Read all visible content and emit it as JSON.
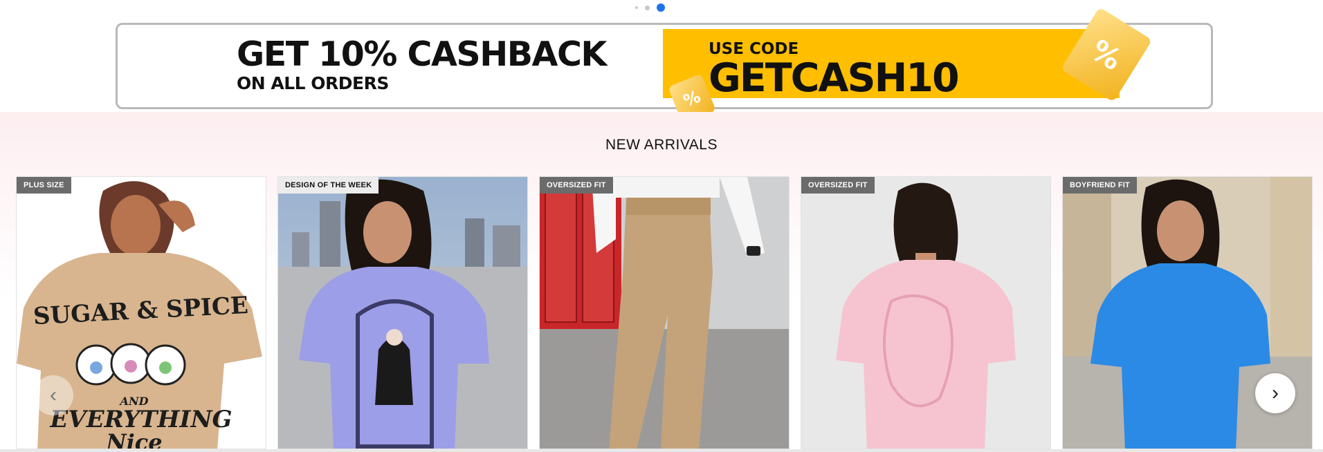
{
  "carousel": {
    "dots": [
      {
        "label": "slide-1",
        "active": false
      },
      {
        "label": "slide-2",
        "active": false
      },
      {
        "label": "slide-3",
        "active": true
      }
    ]
  },
  "banner": {
    "headline": "GET 10% CASHBACK",
    "subline": "ON ALL ORDERS",
    "code_label": "USE CODE",
    "code_value": "GETCASH10",
    "ticket_symbol": "%",
    "colors": {
      "code_bg": "#ffbe00",
      "border": "#b9b9b9"
    }
  },
  "arrivals": {
    "title": "NEW ARRIVALS",
    "products": [
      {
        "tag": "PLUS SIZE",
        "print_text": [
          "SUGAR & SPICE",
          "AND",
          "EVERYTHING",
          "Nice"
        ]
      },
      {
        "tag": "DESIGN OF THE WEEK",
        "print_text": []
      },
      {
        "tag": "OVERSIZED FIT",
        "print_text": []
      },
      {
        "tag": "OVERSIZED FIT",
        "print_text": []
      },
      {
        "tag": "BOYFRIEND FIT",
        "print_text": []
      }
    ],
    "prev_icon": "‹",
    "next_icon": "›"
  }
}
